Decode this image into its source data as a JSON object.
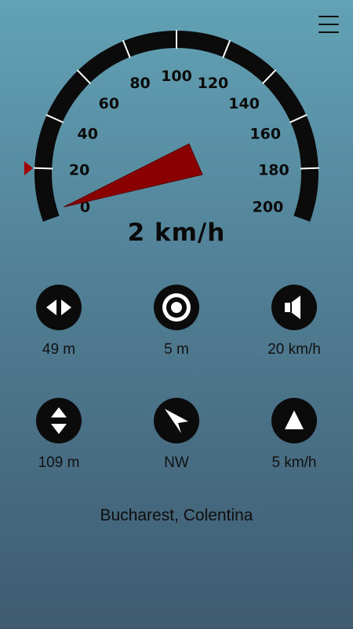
{
  "menu": {
    "icon": "hamburger-menu-icon"
  },
  "speedometer": {
    "tick_labels": [
      "0",
      "20",
      "40",
      "60",
      "80",
      "100",
      "120",
      "140",
      "160",
      "180",
      "200"
    ],
    "max_speed": 200,
    "needle_speed": 2,
    "needle_color": "#8a0000",
    "marker_color": "#a00000",
    "arc_color": "#0b0b0b",
    "readout": "2 km/h"
  },
  "stats": [
    {
      "icon": "horizontal-arrows-icon",
      "value": "49 m"
    },
    {
      "icon": "target-icon",
      "value": "5 m"
    },
    {
      "icon": "speaker-icon",
      "value": "20 km/h"
    },
    {
      "icon": "vertical-arrows-icon",
      "value": "109 m"
    },
    {
      "icon": "compass-pointer-icon",
      "value": "NW"
    },
    {
      "icon": "up-triangle-icon",
      "value": "5 km/h"
    }
  ],
  "location": "Bucharest, Colentina"
}
